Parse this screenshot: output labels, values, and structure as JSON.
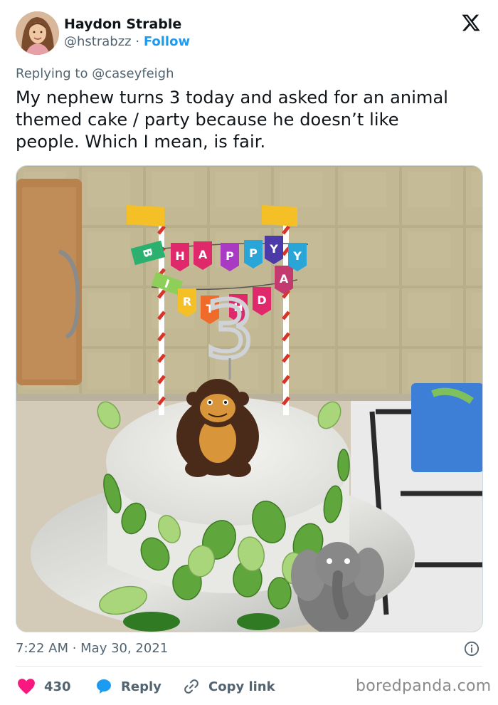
{
  "author": {
    "name": "Haydon Strable",
    "handle": "@hstrabzz",
    "separator": "·",
    "follow_label": "Follow"
  },
  "reply_to": "Replying to @caseyfeigh",
  "tweet": {
    "lines": [
      "My nephew turns 3 today and asked for an animal",
      "themed cake / party because he doesn’t like",
      "people. Which I mean, is fair."
    ]
  },
  "media": {
    "banner_letters": [
      "H",
      "A",
      "P",
      "P",
      "Y",
      "B",
      "I",
      "R",
      "T",
      "H",
      "D",
      "A",
      "Y"
    ],
    "candle_number": "3"
  },
  "meta": {
    "timestamp": "7:22 AM · May 30, 2021"
  },
  "actions": {
    "likes_count": "430",
    "reply_label": "Reply",
    "copy_label": "Copy link"
  },
  "watermark": "boredpanda.com",
  "colors": {
    "accent": "#1d9bf0",
    "like": "#f91880",
    "muted": "#536471"
  }
}
